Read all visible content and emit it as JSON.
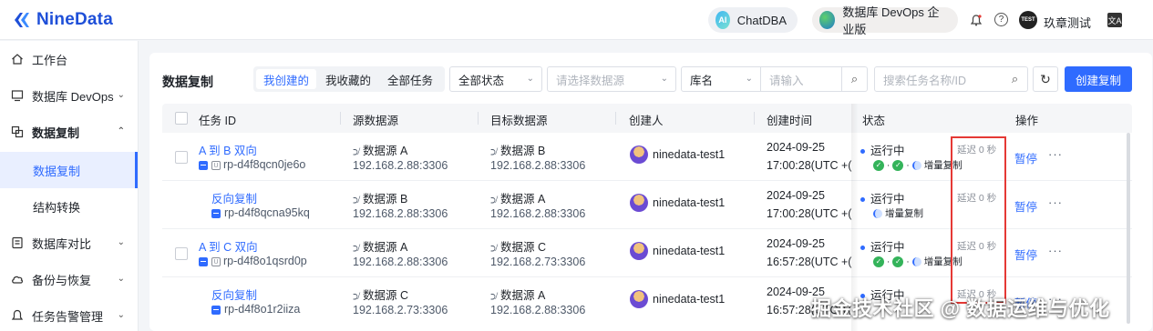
{
  "header": {
    "logo_text": "NineData",
    "chatdba_label": "ChatDBA",
    "chatdba_icon_text": "AI",
    "devops_label": "数据库 DevOps 企业版",
    "bell_icon": "bell-icon",
    "help_symbol": "?",
    "avatar_text": "TEST",
    "username": "玖章测试",
    "lang_icon_text": "文A"
  },
  "sidebar": {
    "items": [
      {
        "label": "工作台",
        "icon": "home-icon"
      },
      {
        "label": "数据库 DevOps",
        "icon": "monitor-icon",
        "chevron": "⌄"
      },
      {
        "label": "数据复制",
        "icon": "copy-icon",
        "chevron": "⌃"
      },
      {
        "label": "数据复制",
        "sub": true,
        "active": true
      },
      {
        "label": "结构转换",
        "sub": true
      },
      {
        "label": "数据库对比",
        "icon": "compare-icon",
        "chevron": "⌄"
      },
      {
        "label": "备份与恢复",
        "icon": "cloud-icon",
        "chevron": "⌄"
      },
      {
        "label": "任务告警管理",
        "icon": "bell-icon",
        "chevron": "⌄"
      }
    ]
  },
  "toolbar": {
    "title": "数据复制",
    "tabs": [
      "我创建的",
      "我收藏的",
      "全部任务"
    ],
    "status_select": "全部状态",
    "datasource_placeholder": "请选择数据源",
    "dbname_select": "库名",
    "input_placeholder": "请输入",
    "search_placeholder": "搜索任务名称/ID",
    "create_button": "创建复制"
  },
  "table": {
    "headers": [
      "任务 ID",
      "源数据源",
      "目标数据源",
      "创建人",
      "创建时间",
      "状态",
      "操作"
    ],
    "rows": [
      {
        "name": "A 到 B 双向",
        "id": "rp-d4f8qcn0je6o",
        "has_u": true,
        "checkbox": true,
        "src_name": "数据源 A",
        "src_ip": "192.168.2.88:3306",
        "dst_name": "数据源 B",
        "dst_ip": "192.168.2.88:3306",
        "creator": "ninedata-test1",
        "date": "2024-09-25",
        "time": "17:00:28(UTC +(",
        "status": "运行中",
        "checks": true,
        "inc_label": "增量复制",
        "delay": "延迟  0 秒",
        "op": "暂停",
        "more": "···"
      },
      {
        "name": "反向复制",
        "id": "rp-d4f8qcna95kq",
        "has_u": false,
        "checkbox": false,
        "src_name": "数据源 B",
        "src_ip": "192.168.2.88:3306",
        "dst_name": "数据源 A",
        "dst_ip": "192.168.2.88:3306",
        "creator": "ninedata-test1",
        "date": "2024-09-25",
        "time": "17:00:28(UTC +(",
        "status": "运行中",
        "checks": false,
        "inc_label": "增量复制",
        "delay": "延迟  0 秒",
        "op": "暂停",
        "more": "···"
      },
      {
        "name": "A 到 C 双向",
        "id": "rp-d4f8o1qsrd0p",
        "has_u": true,
        "checkbox": true,
        "src_name": "数据源 A",
        "src_ip": "192.168.2.88:3306",
        "dst_name": "数据源 C",
        "dst_ip": "192.168.2.73:3306",
        "creator": "ninedata-test1",
        "date": "2024-09-25",
        "time": "16:57:28(UTC +(",
        "status": "运行中",
        "checks": true,
        "inc_label": "增量复制",
        "delay": "延迟  0 秒",
        "op": "暂停",
        "more": "···"
      },
      {
        "name": "反向复制",
        "id": "rp-d4f8o1r2iiza",
        "has_u": false,
        "checkbox": false,
        "src_name": "数据源 C",
        "src_ip": "192.168.2.73:3306",
        "dst_name": "数据源 A",
        "dst_ip": "192.168.2.88:3306",
        "creator": "ninedata-test1",
        "date": "2024-09-25",
        "time": "16:57:28(UTC +(",
        "status": "运行中",
        "checks": false,
        "inc_label": "",
        "delay": "延迟  0 秒",
        "op": "暂停",
        "more": "···"
      }
    ]
  },
  "watermark": "掘金技术社区 @ 数据运维与优化",
  "colors": {
    "accent": "#2f6bff",
    "success": "#34b35a",
    "highlight": "#e53935"
  }
}
